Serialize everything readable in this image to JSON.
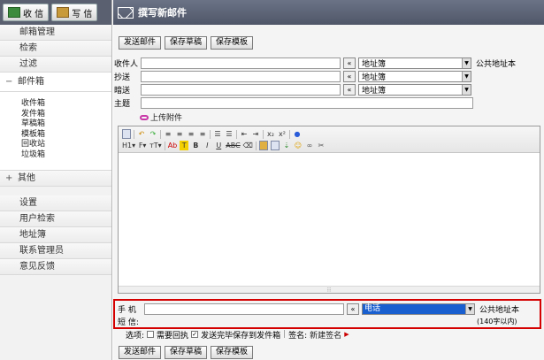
{
  "top_buttons": {
    "receive": "收 信",
    "write": "写 信"
  },
  "sidebar": {
    "items": [
      {
        "label": "邮箱管理"
      },
      {
        "label": "检索"
      },
      {
        "label": "过滤"
      }
    ],
    "mailbox_group": {
      "symbol": "−",
      "label": "邮件箱"
    },
    "folders": [
      "收件箱",
      "发件箱",
      "草稿箱",
      "模板箱",
      "回收站",
      "垃圾箱"
    ],
    "other_group": {
      "symbol": "+",
      "label": "其他"
    },
    "bottom_items": [
      {
        "label": "设置"
      },
      {
        "label": "用户检索"
      },
      {
        "label": "地址簿"
      },
      {
        "label": "联系管理员"
      },
      {
        "label": "意见反馈"
      }
    ]
  },
  "header": {
    "title": "撰写新邮件"
  },
  "actions": {
    "send": "发送邮件",
    "save_draft": "保存草稿",
    "save_template": "保存模板"
  },
  "fields": {
    "to_label": "收件人",
    "cc_label": "抄送",
    "bcc_label": "暗送",
    "subject_label": "主题",
    "picker_button": "«",
    "address_book": "地址簿",
    "public_book": "公共地址本"
  },
  "attach_label": "上传附件",
  "editor": {
    "heading_btn": "H1",
    "font_btn": "F",
    "size_btn": "тT",
    "resize_handle": "⁝⁝"
  },
  "sms": {
    "phone_label": "手 机",
    "sms_label": "短 信:",
    "phone_select": "电话",
    "public_book": "公共地址本",
    "limit": "(140字以内)"
  },
  "options": {
    "label": "选项:",
    "receipt": "需要回执",
    "save_sent": "发送完毕保存到发件箱",
    "signature_label": "签名:",
    "signature_new": "新建签名"
  },
  "colors": {
    "header_bg": "#4e5668",
    "sms_border": "#d40000",
    "select_highlight": "#1a5fd0"
  }
}
